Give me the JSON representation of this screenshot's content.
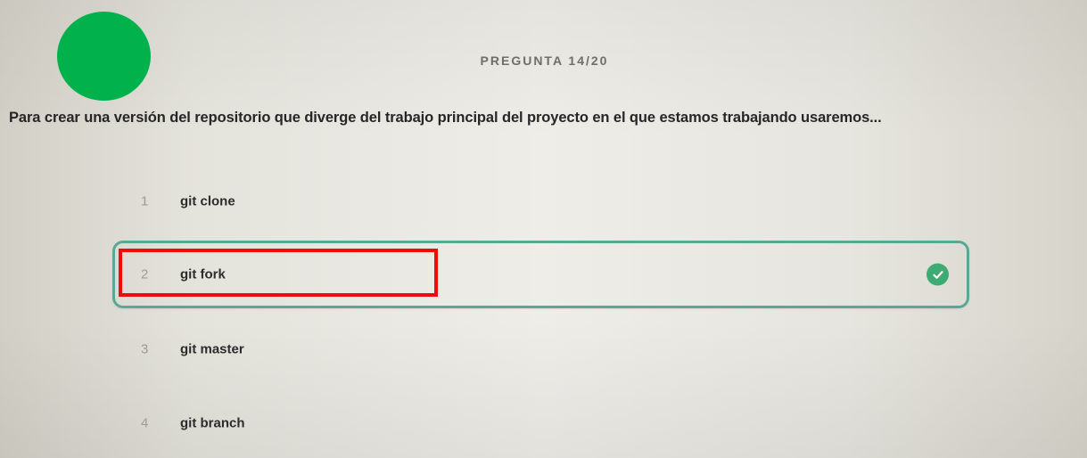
{
  "header": {
    "counter": "PREGUNTA 14/20"
  },
  "question": {
    "text": "Para crear una versión del repositorio que diverge del trabajo principal del proyecto en el que estamos trabajando usaremos..."
  },
  "options": [
    {
      "number": "1",
      "label": "git clone",
      "selected": false
    },
    {
      "number": "2",
      "label": "git fork",
      "selected": true
    },
    {
      "number": "3",
      "label": "git master",
      "selected": false
    },
    {
      "number": "4",
      "label": "git branch",
      "selected": false
    }
  ],
  "icons": {
    "selected_check": "check-circle-icon",
    "status_dot": "green-status-dot"
  },
  "colors": {
    "status_dot": "#00b14c",
    "selected_border": "#5aa893",
    "check": "#3cac74",
    "highlight": "#f20b0b"
  }
}
